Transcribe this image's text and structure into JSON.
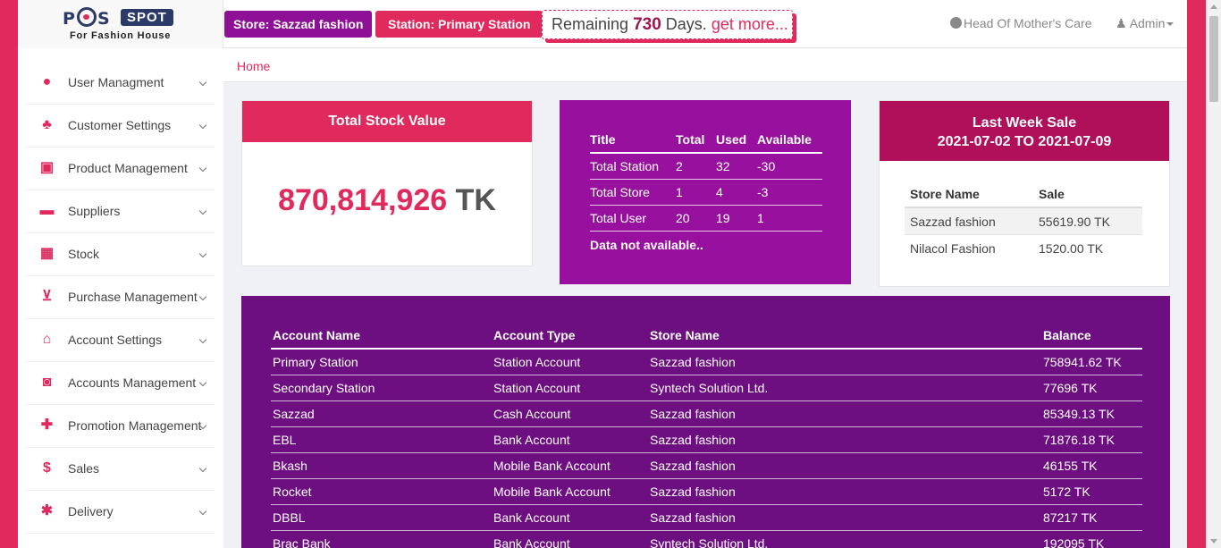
{
  "header": {
    "logo": {
      "pos": "P",
      "pos_tail": "S",
      "spot": "SPOT",
      "tagline": "For Fashion House"
    },
    "store_button": "Store: Sazzad fashion",
    "station_button": "Station: Primary Station",
    "remaining_prefix": "Remaining",
    "remaining_days": "730",
    "remaining_suffix": "Days.",
    "remaining_link": "get more...",
    "org_link": "Head Of Mother's Care",
    "user_menu": "Admin"
  },
  "sidebar": {
    "items": [
      {
        "label": "User Managment",
        "icon": "user-icon",
        "glyph": "●"
      },
      {
        "label": "Customer Settings",
        "icon": "users-icon",
        "glyph": "♣"
      },
      {
        "label": "Product Management",
        "icon": "shopping-bag-icon",
        "glyph": "▣"
      },
      {
        "label": "Suppliers",
        "icon": "truck-icon",
        "glyph": "▬"
      },
      {
        "label": "Stock",
        "icon": "building-icon",
        "glyph": "▦"
      },
      {
        "label": "Purchase Management",
        "icon": "cart-icon",
        "glyph": "⊻"
      },
      {
        "label": "Account Settings",
        "icon": "bank-icon",
        "glyph": "⌂"
      },
      {
        "label": "Accounts Management",
        "icon": "money-icon",
        "glyph": "◙"
      },
      {
        "label": "Promotion Management",
        "icon": "gift-icon",
        "glyph": "✚"
      },
      {
        "label": "Sales",
        "icon": "dollar-icon",
        "glyph": "$"
      },
      {
        "label": "Delivery",
        "icon": "gear-icon",
        "glyph": "✱"
      }
    ]
  },
  "breadcrumb": {
    "home": "Home"
  },
  "stock_card": {
    "title": "Total Stock Value",
    "amount": "870,814,926",
    "unit": "TK"
  },
  "quota_card": {
    "headers": [
      "Title",
      "Total",
      "Used",
      "Available"
    ],
    "rows": [
      [
        "Total Station",
        "2",
        "32",
        "-30"
      ],
      [
        "Total Store",
        "1",
        "4",
        "-3"
      ],
      [
        "Total User",
        "20",
        "19",
        "1"
      ]
    ],
    "note": "Data not available.."
  },
  "week_card": {
    "title": "Last Week Sale",
    "range": "2021-07-02 TO 2021-07-09",
    "headers": [
      "Store Name",
      "Sale"
    ],
    "rows": [
      [
        "Sazzad fashion",
        "55619.90 TK"
      ],
      [
        "Nilacol Fashion",
        "1520.00 TK"
      ]
    ]
  },
  "accounts": {
    "headers": [
      "Account Name",
      "Account Type",
      "Store Name",
      "Balance"
    ],
    "rows": [
      [
        "Primary Station",
        "Station Account",
        "Sazzad fashion",
        "758941.62 TK"
      ],
      [
        "Secondary Station",
        "Station Account",
        "Syntech Solution Ltd.",
        "77696 TK"
      ],
      [
        "Sazzad",
        "Cash Account",
        "Sazzad fashion",
        "85349.13 TK"
      ],
      [
        "EBL",
        "Bank Account",
        "Sazzad fashion",
        "71876.18 TK"
      ],
      [
        "Bkash",
        "Mobile Bank Account",
        "Sazzad fashion",
        "46155 TK"
      ],
      [
        "Rocket",
        "Mobile Bank Account",
        "Sazzad fashion",
        "5172 TK"
      ],
      [
        "DBBL",
        "Bank Account",
        "Sazzad fashion",
        "87217 TK"
      ],
      [
        "Brac Bank",
        "Bank Account",
        "Syntech Solution Ltd.",
        "192095 TK"
      ]
    ]
  },
  "colors": {
    "brand_pink": "#e02a5e",
    "brand_purple": "#98109e",
    "deep_purple": "#6d0f80",
    "maroon": "#b0105a",
    "navy": "#2b3a67"
  }
}
